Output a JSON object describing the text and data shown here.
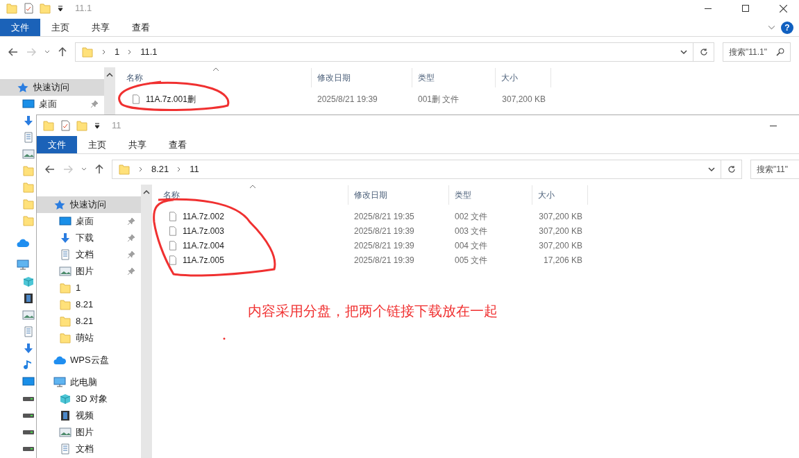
{
  "windows": [
    {
      "title": "11.1",
      "help": "?",
      "ribbon_tabs": [
        {
          "label": "文件",
          "selected": true
        },
        {
          "label": "主页",
          "selected": false
        },
        {
          "label": "共享",
          "selected": false
        },
        {
          "label": "查看",
          "selected": false
        }
      ],
      "path": [
        "1",
        "11.1"
      ],
      "search_placeholder": "搜索\"11.1\"",
      "columns": [
        "名称",
        "修改日期",
        "类型",
        "大小"
      ],
      "sidebar": [
        {
          "label": "快速访问",
          "kind": "star",
          "selected": true,
          "children": [
            {
              "label": "桌面",
              "kind": "desktop",
              "pinned": true
            },
            {
              "kind": "download"
            },
            {
              "kind": "doc"
            },
            {
              "kind": "picture"
            },
            {
              "kind": "folder"
            },
            {
              "kind": "folder"
            },
            {
              "kind": "folder"
            },
            {
              "kind": "folder"
            }
          ]
        },
        {
          "kind": "cloud"
        },
        {
          "kind": "pc",
          "children": [
            {
              "kind": "cube"
            },
            {
              "kind": "video"
            },
            {
              "kind": "picture"
            },
            {
              "kind": "doc"
            },
            {
              "kind": "download"
            },
            {
              "kind": "music"
            },
            {
              "kind": "desktop"
            },
            {
              "kind": "drive"
            },
            {
              "kind": "drive"
            },
            {
              "kind": "drive"
            },
            {
              "kind": "drive"
            }
          ]
        }
      ],
      "files": [
        {
          "name": "11A.7z.001删",
          "date": "2025/8/21 19:39",
          "type": "001删 文件",
          "size": "307,200 KB"
        }
      ]
    },
    {
      "title": "11",
      "ribbon_tabs": [
        {
          "label": "文件",
          "selected": true
        },
        {
          "label": "主页",
          "selected": false
        },
        {
          "label": "共享",
          "selected": false
        },
        {
          "label": "查看",
          "selected": false
        }
      ],
      "path": [
        "8.21",
        "11"
      ],
      "search_placeholder": "搜索\"11\"",
      "columns": [
        "名称",
        "修改日期",
        "类型",
        "大小"
      ],
      "sidebar": [
        {
          "label": "快速访问",
          "kind": "star",
          "selected": true,
          "children": [
            {
              "label": "桌面",
              "kind": "desktop",
              "pinned": true
            },
            {
              "label": "下载",
              "kind": "download",
              "pinned": true
            },
            {
              "label": "文档",
              "kind": "doc",
              "pinned": true
            },
            {
              "label": "图片",
              "kind": "picture",
              "pinned": true
            },
            {
              "label": "1",
              "kind": "folder"
            },
            {
              "label": "8.21",
              "kind": "folder"
            },
            {
              "label": "8.21",
              "kind": "folder"
            },
            {
              "label": "萌站",
              "kind": "folder"
            }
          ]
        },
        {
          "label": "WPS云盘",
          "kind": "cloud",
          "selected": false
        },
        {
          "label": "此电脑",
          "kind": "pc",
          "selected": false,
          "children": [
            {
              "label": "3D 对象",
              "kind": "cube"
            },
            {
              "label": "视频",
              "kind": "video"
            },
            {
              "label": "图片",
              "kind": "picture"
            },
            {
              "label": "文档",
              "kind": "doc"
            }
          ]
        }
      ],
      "files": [
        {
          "name": "11A.7z.002",
          "date": "2025/8/21 19:35",
          "type": "002 文件",
          "size": "307,200 KB"
        },
        {
          "name": "11A.7z.003",
          "date": "2025/8/21 19:39",
          "type": "003 文件",
          "size": "307,200 KB"
        },
        {
          "name": "11A.7z.004",
          "date": "2025/8/21 19:39",
          "type": "004 文件",
          "size": "307,200 KB"
        },
        {
          "name": "11A.7z.005",
          "date": "2025/8/21 19:39",
          "type": "005 文件",
          "size": "17,206 KB"
        }
      ]
    }
  ],
  "annotation": {
    "note": "内容采用分盘，把两个链接下载放在一起"
  }
}
